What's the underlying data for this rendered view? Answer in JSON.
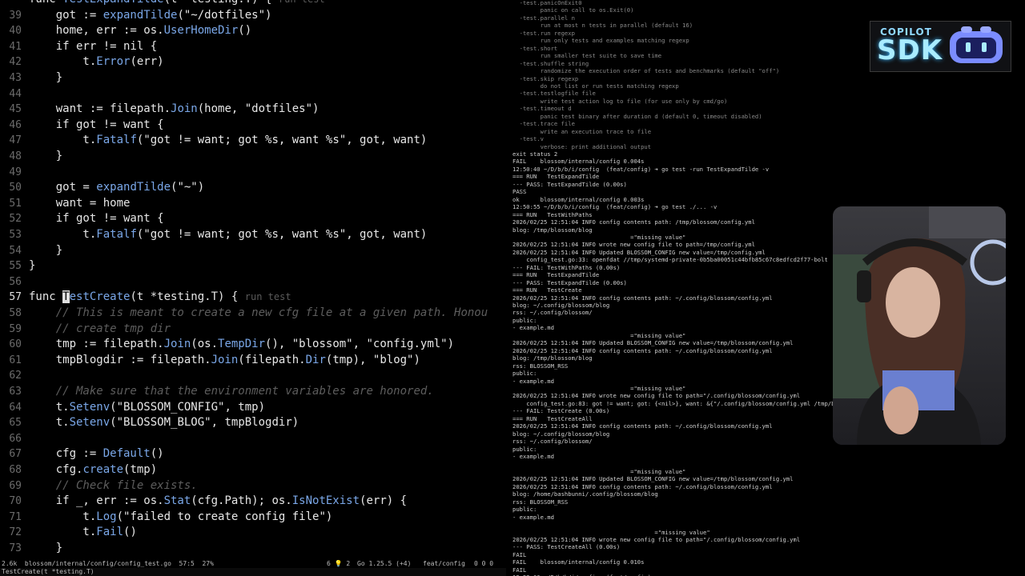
{
  "editor": {
    "lines": [
      {
        "n": "",
        "html": "<span class=\"kw\">func</span> <span class=\"fn\">TestExpandTilde</span>(t *testing.T) { <span class=\"vt\">run test</span>"
      },
      {
        "n": "39",
        "html": "    got := <span class=\"fn\">expandTilde</span>(<span class=\"str\">\"~/dotfiles\"</span>)"
      },
      {
        "n": "40",
        "html": "    home, err := os.<span class=\"fn\">UserHomeDir</span>()"
      },
      {
        "n": "41",
        "html": "    if err != nil {"
      },
      {
        "n": "42",
        "html": "        t.<span class=\"fn\">Error</span>(err)"
      },
      {
        "n": "43",
        "html": "    }"
      },
      {
        "n": "44",
        "html": ""
      },
      {
        "n": "45",
        "html": "    want := filepath.<span class=\"fn\">Join</span>(home, <span class=\"str\">\"dotfiles\"</span>)"
      },
      {
        "n": "46",
        "html": "    if got != want {"
      },
      {
        "n": "47",
        "html": "        t.<span class=\"fn\">Fatalf</span>(<span class=\"str\">\"got != want; got %s, want %s\"</span>, got, want)"
      },
      {
        "n": "48",
        "html": "    }"
      },
      {
        "n": "49",
        "html": ""
      },
      {
        "n": "50",
        "html": "    got = <span class=\"fn\">expandTilde</span>(<span class=\"str\">\"~\"</span>)"
      },
      {
        "n": "51",
        "html": "    want = home"
      },
      {
        "n": "52",
        "html": "    if got != want {"
      },
      {
        "n": "53",
        "html": "        t.<span class=\"fn\">Fatalf</span>(<span class=\"str\">\"got != want; got %s, want %s\"</span>, got, want)"
      },
      {
        "n": "54",
        "html": "    }"
      },
      {
        "n": "55",
        "html": "}"
      },
      {
        "n": "56",
        "html": ""
      },
      {
        "n": "57",
        "cur": true,
        "html": "<span class=\"kw\">func</span> <span class=\"cursor\">T</span><span class=\"fn\">estCreate</span>(t *testing.T) { <span class=\"vt\">run test</span>"
      },
      {
        "n": "58",
        "html": "    <span class=\"cm\">// This is meant to create a new cfg file at a given path. Honou</span>"
      },
      {
        "n": "59",
        "html": "    <span class=\"cm\">// create tmp dir</span>"
      },
      {
        "n": "60",
        "html": "    tmp := filepath.<span class=\"fn\">Join</span>(os.<span class=\"fn\">TempDir</span>(), <span class=\"str\">\"blossom\"</span>, <span class=\"str\">\"config.yml\"</span>)"
      },
      {
        "n": "61",
        "html": "    tmpBlogdir := filepath.<span class=\"fn\">Join</span>(filepath.<span class=\"fn\">Dir</span>(tmp), <span class=\"str\">\"blog\"</span>)"
      },
      {
        "n": "62",
        "html": ""
      },
      {
        "n": "63",
        "html": "    <span class=\"cm\">// Make sure that the environment variables are honored.</span>"
      },
      {
        "n": "64",
        "html": "    t.<span class=\"fn\">Setenv</span>(<span class=\"str\">\"BLOSSOM_CONFIG\"</span>, tmp)"
      },
      {
        "n": "65",
        "html": "    t.<span class=\"fn\">Setenv</span>(<span class=\"str\">\"BLOSSOM_BLOG\"</span>, tmpBlogdir)"
      },
      {
        "n": "66",
        "html": ""
      },
      {
        "n": "67",
        "html": "    cfg := <span class=\"fn\">Default</span>()"
      },
      {
        "n": "68",
        "html": "    cfg.<span class=\"fn\">create</span>(tmp)"
      },
      {
        "n": "69",
        "html": "    <span class=\"cm\">// Check file exists.</span>"
      },
      {
        "n": "70",
        "html": "    if _, err := os.<span class=\"fn\">Stat</span>(cfg.Path); os.<span class=\"fn\">IsNotExist</span>(err) {"
      },
      {
        "n": "71",
        "html": "        t.<span class=\"fn\">Log</span>(<span class=\"str\">\"failed to create config file\"</span>)"
      },
      {
        "n": "72",
        "html": "        t.<span class=\"fn\">Fail</span>()"
      },
      {
        "n": "73",
        "html": "    }"
      }
    ]
  },
  "statusbar": {
    "left": "2.6k  blossom/internal/config/config_test.go  57:5  27%",
    "diag": "6 💡 2",
    "go_version": "Go 1.25.5 (+4)",
    "branch": "feat/config",
    "errors": "0 0 0"
  },
  "cmdline": "TestCreate(t *testing.T)",
  "terminal": {
    "lines": [
      {
        "t": "  -test.panicOnExit0",
        "c": "dim"
      },
      {
        "t": "        panic on call to os.Exit(0)",
        "c": "dim"
      },
      {
        "t": "  -test.parallel n",
        "c": "dim"
      },
      {
        "t": "        run at most n tests in parallel (default 16)",
        "c": "dim"
      },
      {
        "t": "  -test.run regexp",
        "c": "dim"
      },
      {
        "t": "        run only tests and examples matching regexp",
        "c": "dim"
      },
      {
        "t": "  -test.short",
        "c": "dim"
      },
      {
        "t": "        run smaller test suite to save time",
        "c": "dim"
      },
      {
        "t": "  -test.shuffle string",
        "c": "dim"
      },
      {
        "t": "        randomize the execution order of tests and benchmarks (default \"off\")",
        "c": "dim"
      },
      {
        "t": "  -test.skip regexp",
        "c": "dim"
      },
      {
        "t": "        do not list or run tests matching regexp",
        "c": "dim"
      },
      {
        "t": "  -test.testlogfile file",
        "c": "dim"
      },
      {
        "t": "        write test action log to file (for use only by cmd/go)",
        "c": "dim"
      },
      {
        "t": "  -test.timeout d",
        "c": "dim"
      },
      {
        "t": "        panic test binary after duration d (default 0, timeout disabled)",
        "c": "dim"
      },
      {
        "t": "  -test.trace file",
        "c": "dim"
      },
      {
        "t": "        write an execution trace to file",
        "c": "dim"
      },
      {
        "t": "  -test.v",
        "c": "dim"
      },
      {
        "t": "        verbose: print additional output",
        "c": "dim"
      },
      {
        "t": "exit status 2",
        "c": ""
      },
      {
        "t": "FAIL    blossom/internal/config 0.004s",
        "c": ""
      },
      {
        "t": "12:50:40 ~/D/b/b/i/config  (feat/config) ➜ go test -run TestExpandTilde -v",
        "c": "prompt"
      },
      {
        "t": "=== RUN   TestExpandTilde",
        "c": ""
      },
      {
        "t": "--- PASS: TestExpandTilde (0.00s)",
        "c": ""
      },
      {
        "t": "PASS",
        "c": ""
      },
      {
        "t": "ok      blossom/internal/config 0.003s",
        "c": ""
      },
      {
        "t": "12:50:55 ~/D/b/b/i/config  (feat/config) ➜ go test ./... -v",
        "c": "prompt"
      },
      {
        "t": "=== RUN   TestWithPaths",
        "c": ""
      },
      {
        "t": "2026/02/25 12:51:04 INFO config contents path: /tmp/blossom/config.yml",
        "c": ""
      },
      {
        "t": "blog: /tmp/blossom/blog",
        "c": ""
      },
      {
        "t": "                                  =\"missing value\"",
        "c": ""
      },
      {
        "t": "2026/02/25 12:51:04 INFO wrote new config file to path=/tmp/config.yml",
        "c": ""
      },
      {
        "t": "2026/02/25 12:51:04 INFO Updated BLOSSOM_CONFIG new value=/tmp/config.yml",
        "c": ""
      },
      {
        "t": "    config_test.go:33: openfdat //tmp/systemd-private-0b5ba00051c44bfb85c67c8edfcd2f77-bolt",
        "c": ""
      },
      {
        "t": "--- FAIL: TestWithPaths (0.00s)",
        "c": ""
      },
      {
        "t": "=== RUN   TestExpandTilde",
        "c": ""
      },
      {
        "t": "--- PASS: TestExpandTilde (0.00s)",
        "c": ""
      },
      {
        "t": "=== RUN   TestCreate",
        "c": ""
      },
      {
        "t": "2026/02/25 12:51:04 INFO config contents path: ~/.config/blossom/config.yml",
        "c": ""
      },
      {
        "t": "blog: ~/.config/blossom/blog",
        "c": ""
      },
      {
        "t": "rss: ~/.config/blossom/",
        "c": ""
      },
      {
        "t": "public:",
        "c": ""
      },
      {
        "t": "- example.md",
        "c": ""
      },
      {
        "t": "                                  =\"missing value\"",
        "c": ""
      },
      {
        "t": "2026/02/25 12:51:04 INFO Updated BLOSSOM_CONFIG new value=/tmp/blossom/config.yml",
        "c": ""
      },
      {
        "t": "2026/02/25 12:51:04 INFO config contents path: ~/.config/blossom/config.yml",
        "c": ""
      },
      {
        "t": "blog: /tmp/blossom/blog",
        "c": ""
      },
      {
        "t": "rss: BLOSSOM_RSS",
        "c": ""
      },
      {
        "t": "public:",
        "c": ""
      },
      {
        "t": "- example.md",
        "c": ""
      },
      {
        "t": "                                  =\"missing value\"",
        "c": ""
      },
      {
        "t": "2026/02/25 12:51:04 INFO wrote new config file to path=\"/.config/blossom/config.yml",
        "c": ""
      },
      {
        "t": "    config_test.go:83: got != want; got: {<nil>}, want: &{\"/.config/blossom/config.yml /tmp/b",
        "c": ""
      },
      {
        "t": "--- FAIL: TestCreate (0.00s)",
        "c": ""
      },
      {
        "t": "=== RUN   TestCreateAll",
        "c": ""
      },
      {
        "t": "2026/02/25 12:51:04 INFO config contents path: ~/.config/blossom/config.yml",
        "c": ""
      },
      {
        "t": "blog: ~/.config/blossom/blog",
        "c": ""
      },
      {
        "t": "rss: ~/.config/blossom/",
        "c": ""
      },
      {
        "t": "public:",
        "c": ""
      },
      {
        "t": "- example.md",
        "c": ""
      },
      {
        "t": "",
        "c": ""
      },
      {
        "t": "                                  =\"missing value\"",
        "c": ""
      },
      {
        "t": "2026/02/25 12:51:04 INFO Updated BLOSSOM_CONFIG new value=/tmp/blossom/config.yml",
        "c": ""
      },
      {
        "t": "2026/02/25 12:51:04 INFO config contents path: ~/.config/blossom/config.yml",
        "c": ""
      },
      {
        "t": "blog: /home/bashbunni/.config/blossom/blog",
        "c": ""
      },
      {
        "t": "rss: BLOSSOM_RSS",
        "c": ""
      },
      {
        "t": "public:",
        "c": ""
      },
      {
        "t": "- example.md",
        "c": ""
      },
      {
        "t": "",
        "c": ""
      },
      {
        "t": "                                         =\"missing value\"",
        "c": ""
      },
      {
        "t": "2026/02/25 12:51:04 INFO wrote new config file to path=\"/.config/blossom/config.yml",
        "c": ""
      },
      {
        "t": "--- PASS: TestCreateAll (0.00s)",
        "c": ""
      },
      {
        "t": "FAIL",
        "c": ""
      },
      {
        "t": "FAIL    blossom/internal/config 0.010s",
        "c": ""
      },
      {
        "t": "FAIL",
        "c": ""
      },
      {
        "t": "12:52:06 ~/D/b/b/i/config  (feat/config) ➜ ",
        "c": "prompt"
      }
    ]
  },
  "overlay": {
    "logo_top": "COPILOT",
    "logo_main": "SDK"
  }
}
